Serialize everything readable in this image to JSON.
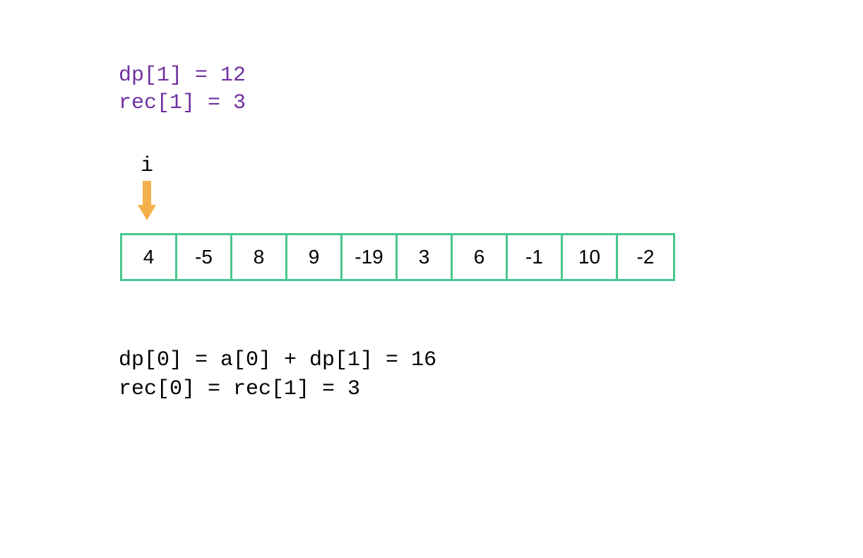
{
  "chart_data": {
    "type": "table",
    "title": "Dynamic Programming Array Iteration",
    "array_values": [
      4,
      -5,
      8,
      9,
      -19,
      3,
      6,
      -1,
      10,
      -2
    ],
    "pointer_index": 0,
    "pointer_label": "i",
    "state": {
      "dp_1": 12,
      "rec_1": 3
    },
    "computation": {
      "dp_0_formula": "a[0] + dp[1]",
      "dp_0_result": 16,
      "rec_0_formula": "rec[1]",
      "rec_0_result": 3
    }
  },
  "state_lines": {
    "line1": "dp[1] = 12",
    "line2": "rec[1] = 3"
  },
  "pointer": {
    "label": "i"
  },
  "array": {
    "cell0": "4",
    "cell1": "-5",
    "cell2": "8",
    "cell3": "9",
    "cell4": "-19",
    "cell5": "3",
    "cell6": "6",
    "cell7": "-1",
    "cell8": "10",
    "cell9": "-2"
  },
  "computation_lines": {
    "line1": "dp[0] = a[0] + dp[1] = 16",
    "line2": "rec[0] = rec[1] = 3"
  }
}
